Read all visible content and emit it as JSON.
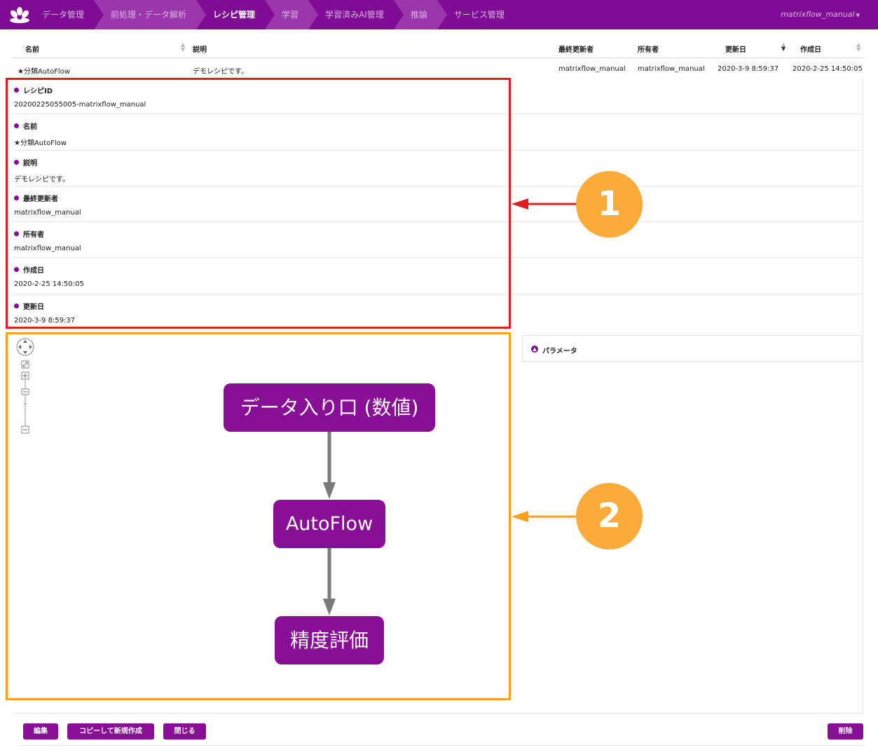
{
  "nav": {
    "user": "matrixflow_manual",
    "crumbs": [
      {
        "label": "データ管理",
        "active": false
      },
      {
        "label": "前処理・データ解析",
        "active": false
      },
      {
        "label": "レシピ管理",
        "active": true
      },
      {
        "label": "学習",
        "active": false
      },
      {
        "label": "学習済みAI管理",
        "active": false
      },
      {
        "label": "推論",
        "active": false
      },
      {
        "label": "サービス管理",
        "active": false
      }
    ]
  },
  "table": {
    "headers": {
      "name": "名前",
      "description": "説明",
      "updater": "最終更新者",
      "owner": "所有者",
      "updated": "更新日",
      "created": "作成日"
    },
    "row": {
      "name": "★分類AutoFlow",
      "description": "デモレシピです。",
      "updater": "matrixflow_manual",
      "owner": "matrixflow_manual",
      "updated": "2020-3-9 8:59:37",
      "created": "2020-2-25 14:50:05"
    }
  },
  "detail": [
    {
      "label": "レシピID",
      "value": "20200225055005-matrixflow_manual"
    },
    {
      "label": "名前",
      "value": "★分類AutoFlow"
    },
    {
      "label": "説明",
      "value": "デモレシピです。"
    },
    {
      "label": "最終更新者",
      "value": "matrixflow_manual"
    },
    {
      "label": "所有者",
      "value": "matrixflow_manual"
    },
    {
      "label": "作成日",
      "value": "2020-2-25 14:50:05"
    },
    {
      "label": "更新日",
      "value": "2020-3-9 8:59:37"
    }
  ],
  "parameters": {
    "label": "パラメータ"
  },
  "flow": {
    "nodes": [
      "データ入り口 (数値)",
      "AutoFlow",
      "精度評価"
    ]
  },
  "callouts": [
    "1",
    "2"
  ],
  "buttons": {
    "edit": "編集",
    "copy": "コピーして新規作成",
    "close": "閉じる",
    "delete": "削除"
  },
  "colors": {
    "brand": "#800b94",
    "callout": "#fbab3a",
    "box1": "#e02020",
    "box2": "#ff9f1a"
  }
}
